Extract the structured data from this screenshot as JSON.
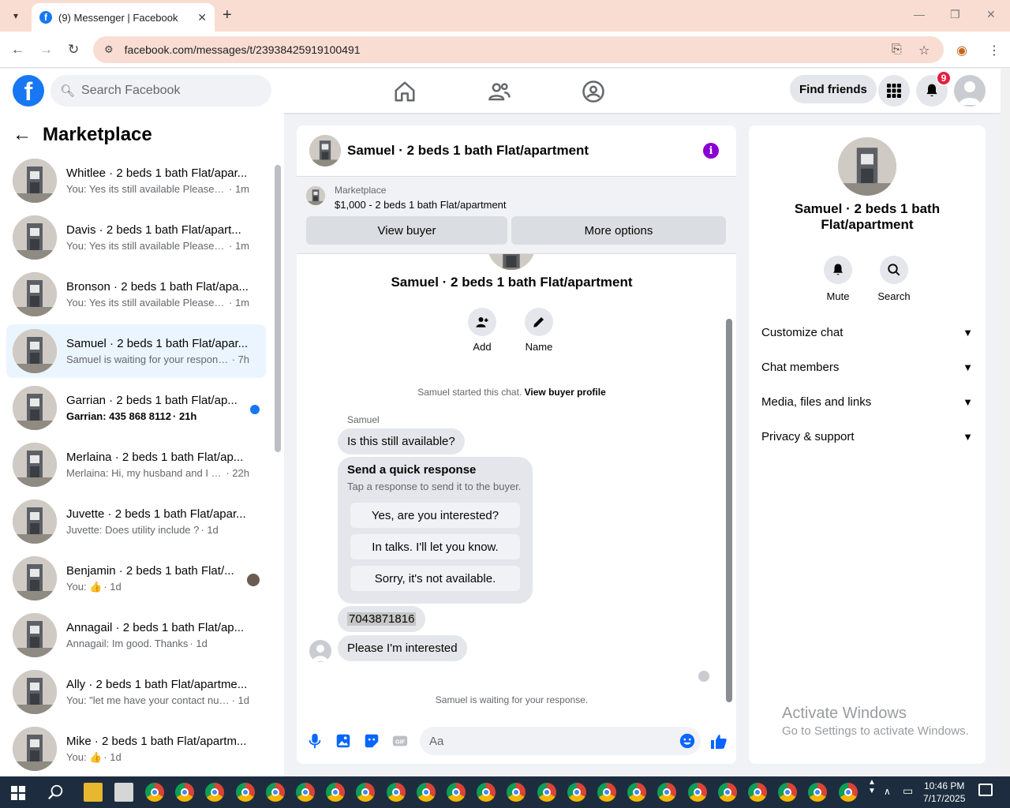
{
  "browser": {
    "tab_title": "(9) Messenger | Facebook",
    "url": "facebook.com/messages/t/23938425919100491"
  },
  "fb": {
    "search_placeholder": "Search Facebook",
    "find_friends": "Find friends",
    "notif_count": "9",
    "brand_color": "#1877f2"
  },
  "left": {
    "title": "Marketplace",
    "conversations": [
      {
        "name": "Whitlee · 2 beds 1 bath Flat/apar...",
        "preview": "You: Yes its still available Please se...",
        "time": " · 1m"
      },
      {
        "name": "Davis · 2 beds 1 bath Flat/apart...",
        "preview": "You: Yes its still available Please se...",
        "time": " · 1m"
      },
      {
        "name": "Bronson · 2 beds 1 bath Flat/apa...",
        "preview": "You: Yes its still available Please se...",
        "time": " · 1m"
      },
      {
        "name": "Samuel · 2 beds 1 bath Flat/apar...",
        "preview": "Samuel is waiting for your response.",
        "time": " · 7h"
      },
      {
        "name": "Garrian · 2 beds 1 bath Flat/ap...",
        "preview": "Garrian: 435 868 8112",
        "time": " · 21h"
      },
      {
        "name": "Merlaina · 2 beds 1 bath Flat/ap...",
        "preview": "Merlaina: Hi, my husband and I ar...",
        "time": " · 22h"
      },
      {
        "name": "Juvette · 2 beds 1 bath Flat/apar...",
        "preview": "Juvette: Does utility include ?",
        "time": " · 1d"
      },
      {
        "name": "Benjamin · 2 beds 1 bath Flat/...",
        "preview": "You: 👍",
        "time": " · 1d"
      },
      {
        "name": "Annagail · 2 beds 1 bath Flat/ap...",
        "preview": "Annagail: Im good. Thanks",
        "time": " · 1d"
      },
      {
        "name": "Ally · 2 beds 1 bath Flat/apartme...",
        "preview": "You: \"let me have your contact num...",
        "time": " · 1d"
      },
      {
        "name": "Mike · 2 beds 1 bath Flat/apartm...",
        "preview": "You: 👍",
        "time": " · 1d"
      }
    ]
  },
  "chat": {
    "title": "Samuel · 2 beds 1 bath Flat/apartment",
    "marketplace_label": "Marketplace",
    "listing": "$1,000 - 2 beds 1 bath Flat/apartment",
    "view_buyer": "View buyer",
    "more_options": "More options",
    "add_label": "Add",
    "name_label": "Name",
    "started_text": "Samuel started this chat.",
    "view_buyer_profile": "View buyer profile",
    "sender": "Samuel",
    "msg1": "Is this still available?",
    "quick_title": "Send a quick response",
    "quick_sub": "Tap a response to send it to the buyer.",
    "quick_options": [
      "Yes, are you interested?",
      "In talks. I'll let you know.",
      "Sorry, it's not available."
    ],
    "phone": "7043871816",
    "msg2": "Please I'm interested",
    "waiting": "Samuel is waiting for your response.",
    "input_placeholder": "Aa"
  },
  "right": {
    "name": "Samuel · 2 beds 1 bath Flat/apartment",
    "mute": "Mute",
    "search": "Search",
    "sections": [
      "Customize chat",
      "Chat members",
      "Media, files and links",
      "Privacy & support"
    ],
    "activate_title": "Activate Windows",
    "activate_sub": "Go to Settings to activate Windows."
  },
  "taskbar": {
    "time": "10:46 PM",
    "date": "7/17/2025"
  }
}
